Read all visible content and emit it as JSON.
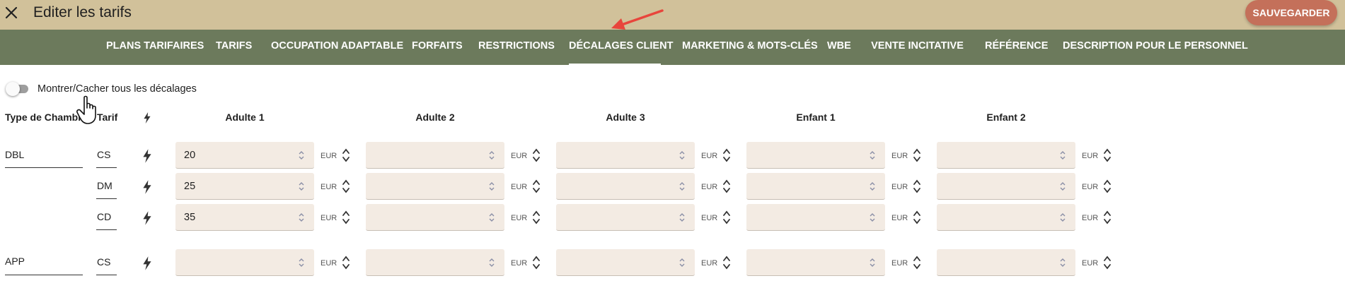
{
  "header": {
    "title": "Editer les tarifs",
    "save_label": "SAUVEGARDER",
    "close_icon": "close-icon"
  },
  "tabs": [
    {
      "label": "PLANS TARIFAIRES",
      "active": false
    },
    {
      "label": "TARIFS",
      "active": false
    },
    {
      "label": "OCCUPATION ADAPTABLE",
      "active": false
    },
    {
      "label": "FORFAITS",
      "active": false
    },
    {
      "label": "RESTRICTIONS",
      "active": false
    },
    {
      "label": "DÉCALAGES CLIENT",
      "active": true
    },
    {
      "label": "MARKETING & MOTS-CLÉS",
      "active": false
    },
    {
      "label": "WBE",
      "active": false
    },
    {
      "label": "VENTE INCITATIVE",
      "active": false
    },
    {
      "label": "RÉFÉRENCE",
      "active": false
    },
    {
      "label": "DESCRIPTION POUR LE PERSONNEL",
      "active": false
    }
  ],
  "toggle": {
    "label": "Montrer/Cacher tous les décalages",
    "on": false
  },
  "table": {
    "col_room_type": "Type de Chambre",
    "col_rate": "Tarif",
    "columns": [
      "Adulte 1",
      "Adulte 2",
      "Adulte 3",
      "Enfant 1",
      "Enfant 2"
    ],
    "currency": "EUR",
    "rows": [
      {
        "room": "DBL",
        "rate": "CS",
        "values": [
          "20",
          "",
          "",
          "",
          ""
        ]
      },
      {
        "room": "",
        "rate": "DM",
        "values": [
          "25",
          "",
          "",
          "",
          ""
        ]
      },
      {
        "room": "",
        "rate": "CD",
        "values": [
          "35",
          "",
          "",
          "",
          ""
        ]
      },
      {
        "room": "APP",
        "rate": "CS",
        "values": [
          "",
          "",
          "",
          "",
          ""
        ]
      }
    ]
  },
  "colors": {
    "topbar": "#d1c19a",
    "tabbar": "#6c7a5c",
    "save_button": "#c4705a",
    "field_bg": "#f3ebe3",
    "annotation_arrow": "#e8453c"
  }
}
